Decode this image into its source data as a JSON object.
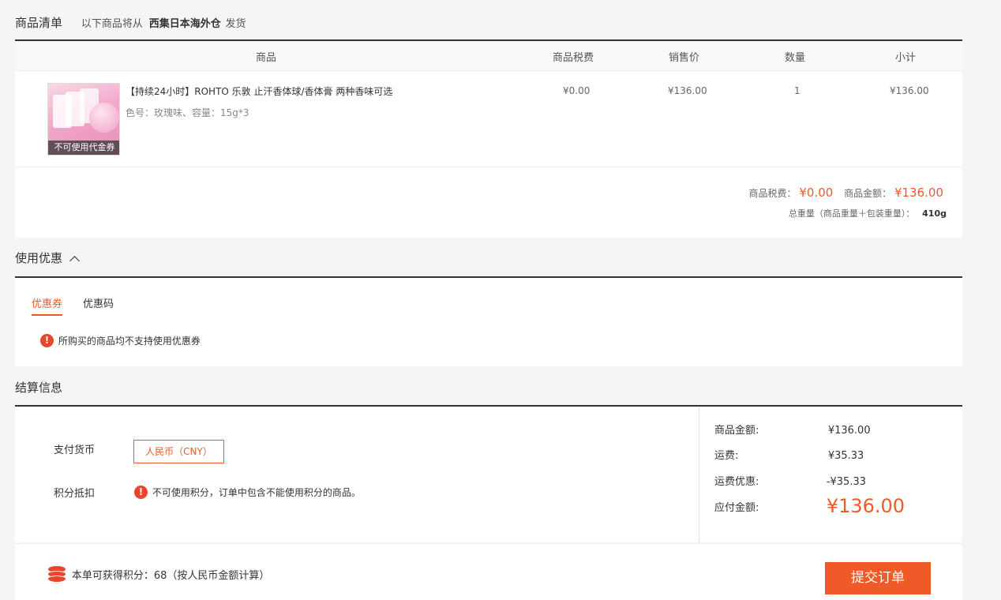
{
  "header": {
    "title": "商品清单",
    "ship_prefix": "以下商品将从",
    "warehouse": "西集日本海外仓",
    "ship_suffix": "发货"
  },
  "table": {
    "columns": [
      "商品",
      "商品税费",
      "销售价",
      "数量",
      "小计"
    ],
    "item": {
      "name": "【持续24小时】ROHTO 乐敦 止汗香体球/香体膏 两种香味可选",
      "spec": "色号：玫瑰味、容量：15g*3",
      "badge": "不可使用代金券",
      "tax": "¥0.00",
      "price": "¥136.00",
      "qty": "1",
      "subtotal": "¥136.00",
      "image_label": "ROHTO product pink balls"
    }
  },
  "summary": {
    "tax_label": "商品税费：",
    "tax_value": "¥0.00",
    "amount_label": "商品金额：",
    "amount_value": "¥136.00",
    "weight_label": "总重量（商品重量＋包装重量）：",
    "weight_value": "410g"
  },
  "promo": {
    "title": "使用优惠",
    "tabs": [
      "优惠券",
      "优惠码"
    ],
    "notice": "所购买的商品均不支持使用优惠券"
  },
  "settle": {
    "title": "结算信息",
    "currency_label": "支付货币",
    "currency_value": "人民币（CNY）",
    "points_label": "积分抵扣",
    "points_notice": "不可使用积分，订单中包含不能使用积分的商品。",
    "rows": [
      {
        "label": "商品金额:",
        "value": "¥136.00"
      },
      {
        "label": "运费:",
        "value": "¥35.33"
      },
      {
        "label": "运费优惠:",
        "value": "-¥35.33"
      }
    ],
    "payable_label": "应付金额:",
    "payable_value": "¥136.00"
  },
  "footer": {
    "points_text": "本单可获得积分：68（按人民币金额计算）",
    "submit": "提交订单"
  },
  "colors": {
    "accent": "#f05a28",
    "warn": "#e8462a"
  }
}
